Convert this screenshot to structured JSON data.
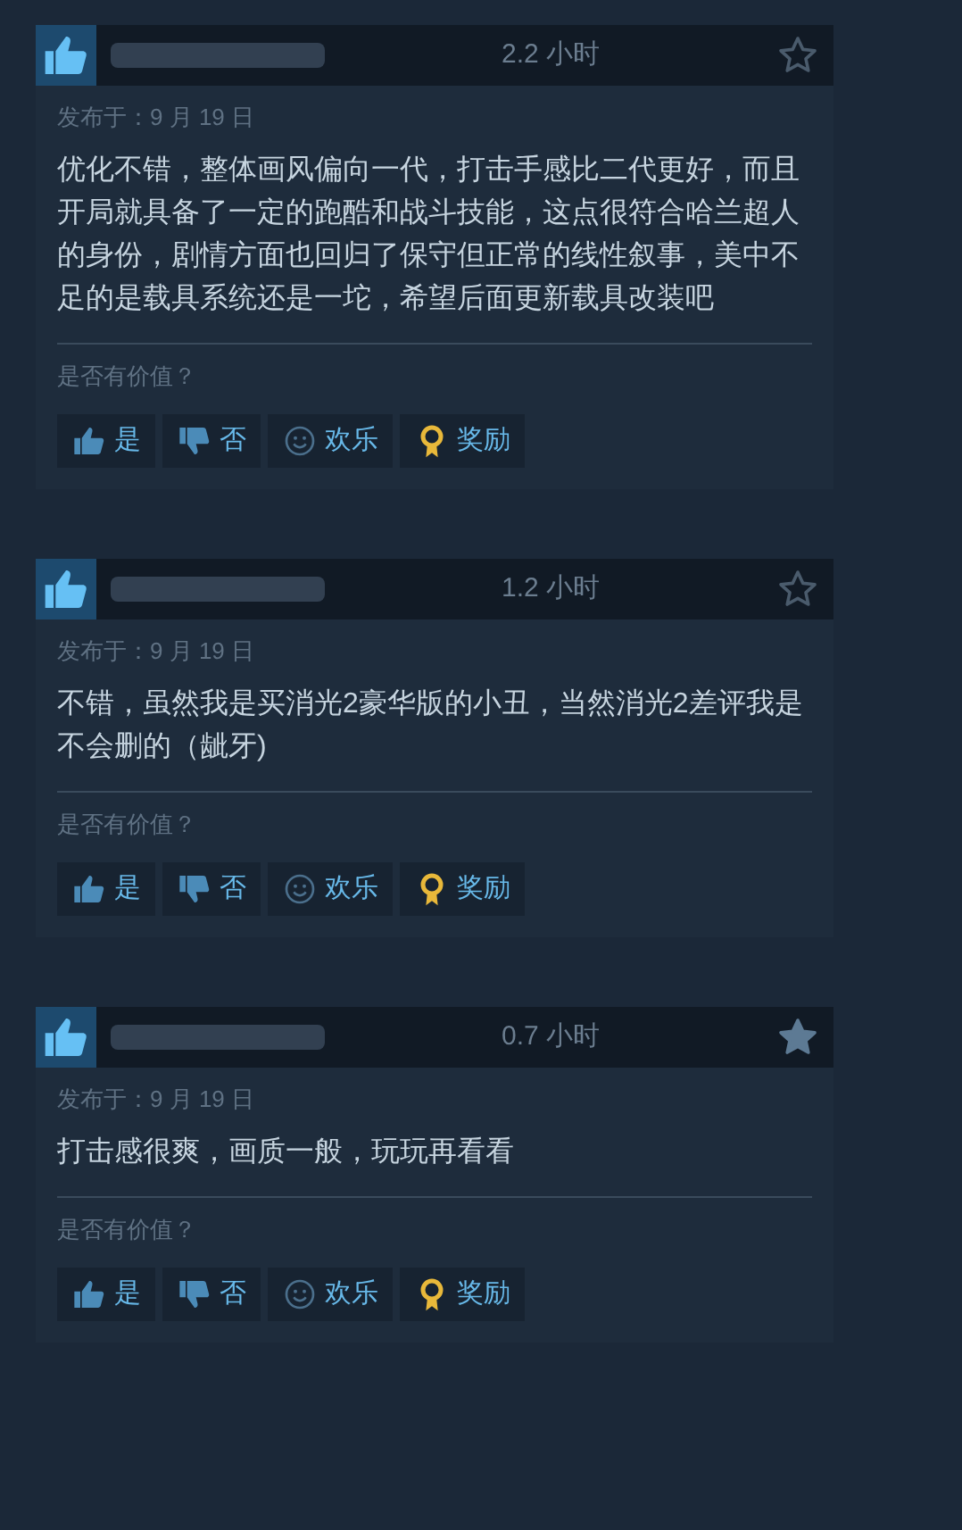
{
  "reviews": [
    {
      "recommended": true,
      "hours": "2.2 小时",
      "starred": false,
      "date": "发布于：9 月 19 日",
      "text": "优化不错，整体画风偏向一代，打击手感比二代更好，而且开局就具备了一定的跑酷和战斗技能，这点很符合哈兰超人的身份，剧情方面也回归了保守但正常的线性叙事，美中不足的是载具系统还是一坨，希望后面更新载具改装吧",
      "helpful_prompt": "是否有价值？",
      "actions": [
        {
          "kind": "yes",
          "label": "是"
        },
        {
          "kind": "no",
          "label": "否"
        },
        {
          "kind": "funny",
          "label": "欢乐"
        },
        {
          "kind": "award",
          "label": "奖励"
        }
      ]
    },
    {
      "recommended": true,
      "hours": "1.2 小时",
      "starred": false,
      "date": "发布于：9 月 19 日",
      "text": "不错，虽然我是买消光2豪华版的小丑，当然消光2差评我是不会删的（龇牙)",
      "helpful_prompt": "是否有价值？",
      "actions": [
        {
          "kind": "yes",
          "label": "是"
        },
        {
          "kind": "no",
          "label": "否"
        },
        {
          "kind": "funny",
          "label": "欢乐"
        },
        {
          "kind": "award",
          "label": "奖励"
        }
      ]
    },
    {
      "recommended": true,
      "hours": "0.7 小时",
      "starred": true,
      "date": "发布于：9 月 19 日",
      "text": "打击感很爽，画质一般，玩玩再看看",
      "helpful_prompt": "是否有价值？",
      "actions": [
        {
          "kind": "yes",
          "label": "是"
        },
        {
          "kind": "no",
          "label": "否"
        },
        {
          "kind": "funny",
          "label": "欢乐"
        },
        {
          "kind": "award",
          "label": "奖励"
        }
      ]
    }
  ]
}
